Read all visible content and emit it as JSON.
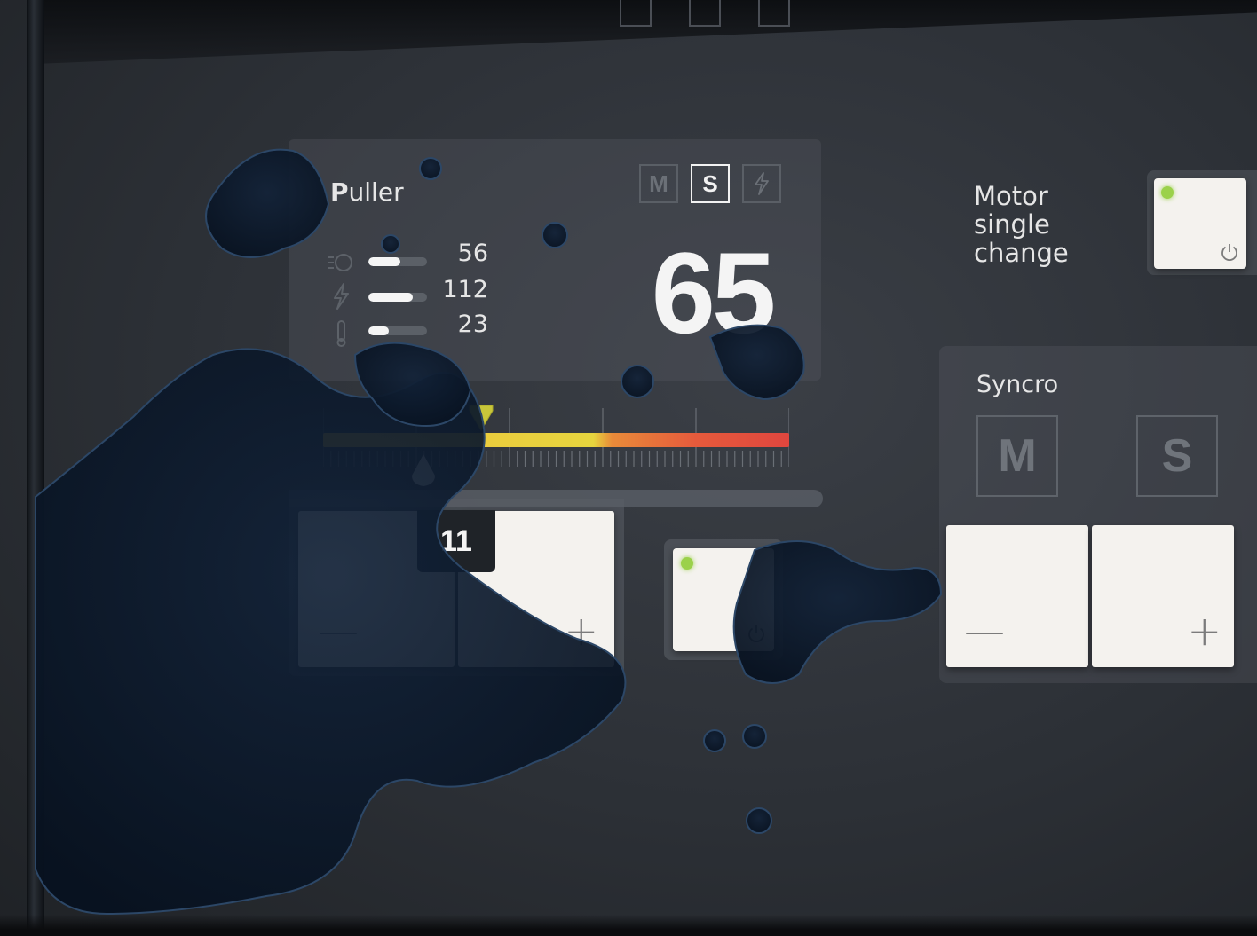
{
  "puller": {
    "title_bold": "P",
    "title_rest": "uller",
    "modes": [
      {
        "label": "M",
        "active": false
      },
      {
        "label": "S",
        "active": true
      },
      {
        "label": "⚡",
        "active": false
      }
    ],
    "main_value": "65",
    "metrics": [
      {
        "icon": "speed-icon",
        "value": "56",
        "level": 0.55
      },
      {
        "icon": "lightning-icon",
        "value": "112",
        "level": 0.75
      },
      {
        "icon": "thermometer-icon",
        "value": "23",
        "level": 0.35
      }
    ],
    "setpoint": "11",
    "minus": "—",
    "plus": "+"
  },
  "motor": {
    "label_line1": "Motor",
    "label_line2": "single",
    "label_line3": "change"
  },
  "syncro": {
    "title": "Syncro",
    "mode_m": "M",
    "mode_s": "S",
    "minus": "—",
    "plus": "+"
  },
  "colors": {
    "led": "#9bd14b",
    "gauge_yellow": "#e6d43e",
    "gauge_red": "#e0463e",
    "tile": "#f4f2ee"
  }
}
